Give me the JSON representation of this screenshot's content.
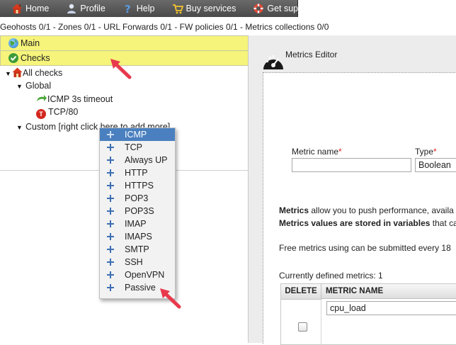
{
  "nav": {
    "items": [
      {
        "label": "Home",
        "icon": "home-icon"
      },
      {
        "label": "Profile",
        "icon": "user-icon"
      },
      {
        "label": "Help",
        "icon": "help-icon"
      },
      {
        "label": "Buy services",
        "icon": "cart-icon"
      },
      {
        "label": "Get support",
        "icon": "lifebuoy-icon"
      }
    ]
  },
  "summary": "Geohosts 0/1 - Zones 0/1 - URL Forwards 0/1 - FW policies 0/1 - Metrics collections 0/0",
  "left": {
    "accordion": [
      {
        "label": "Main",
        "icon": "globe-icon"
      },
      {
        "label": "Checks",
        "icon": "checkmark-icon"
      }
    ],
    "tree": {
      "root": "All checks",
      "global": "Global",
      "check1": "ICMP 3s timeout",
      "check2": "TCP/80",
      "custom": "Custom [right click here to add more]"
    }
  },
  "context_menu": {
    "items": [
      "ICMP",
      "TCP",
      "Always UP",
      "HTTP",
      "HTTPS",
      "POP3",
      "POP3S",
      "IMAP",
      "IMAPS",
      "SMTP",
      "SSH",
      "OpenVPN",
      "Passive"
    ],
    "selected": "ICMP"
  },
  "editor": {
    "title": "Metrics Editor",
    "metric_name_label": "Metric name",
    "metric_name_value": "",
    "type_label": "Type",
    "type_value": "Boolean",
    "required_mark": "*",
    "para1_bold": "Metrics",
    "para1_rest": " allow you to push performance, availa",
    "para2_bold": "Metrics values are stored in variables",
    "para2_rest": " that ca",
    "para3": "Free metrics using can be submitted every 18",
    "defined_count": "Currently defined metrics: 1",
    "table": {
      "headers": [
        "DELETE",
        "METRIC NAME"
      ],
      "rows": [
        {
          "name": "cpu_load",
          "checked": false
        }
      ]
    }
  },
  "colors": {
    "accordion_bg": "#f6f47a",
    "menu_selected": "#4a80bf",
    "arrow": "#e8394d"
  }
}
